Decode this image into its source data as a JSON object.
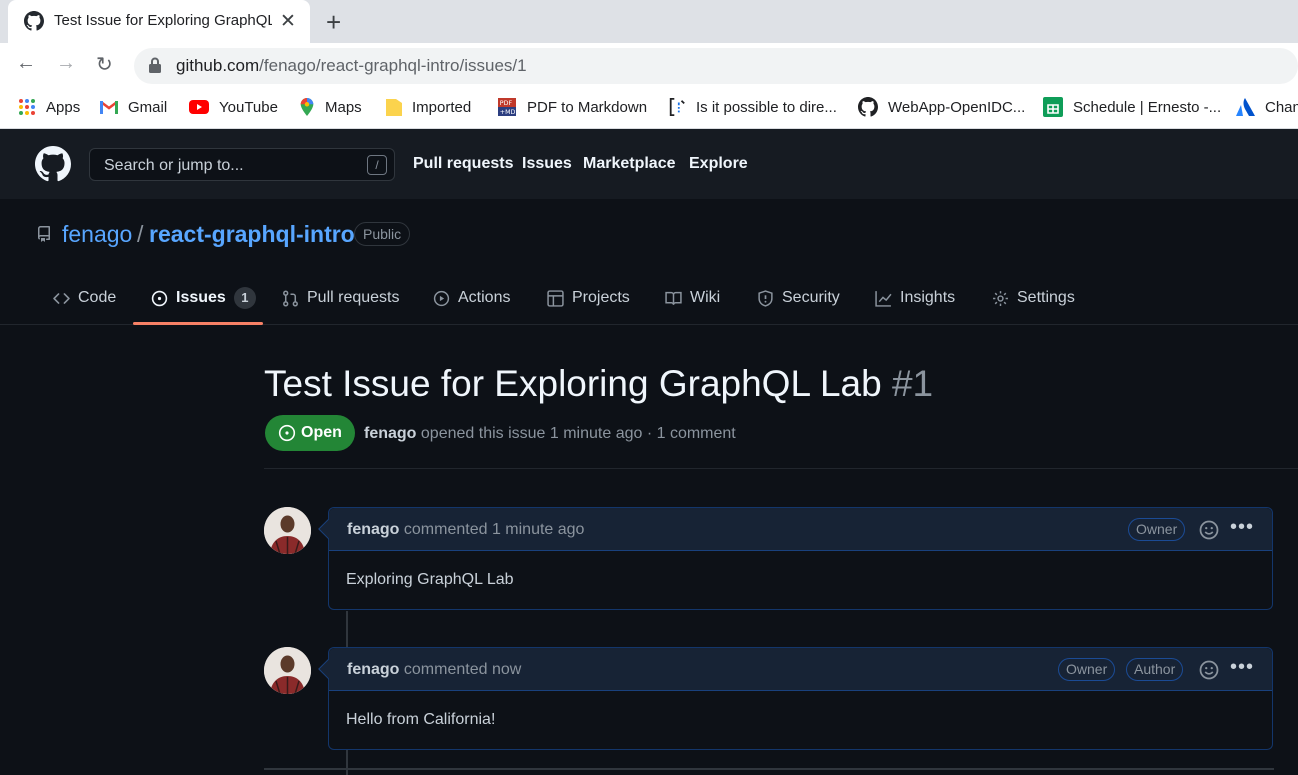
{
  "browser": {
    "tab_title": "Test Issue for Exploring GraphQL",
    "close_glyph": "✕",
    "new_tab_glyph": "+",
    "back_glyph": "←",
    "forward_glyph": "→",
    "reload_glyph": "↻",
    "url_host": "github.com",
    "url_path": "/fenago/react-graphql-intro/issues/1",
    "bookmarks": [
      {
        "label": "Apps",
        "icon": "apps-grid-icon"
      },
      {
        "label": "Gmail",
        "icon": "gmail-icon"
      },
      {
        "label": "YouTube",
        "icon": "youtube-icon"
      },
      {
        "label": "Maps",
        "icon": "maps-pin-icon"
      },
      {
        "label": "Imported",
        "icon": "folder-icon"
      },
      {
        "label": "PDF to Markdown",
        "icon": "pdf-md-icon"
      },
      {
        "label": "Is it possible to dire...",
        "icon": "bracket-icon"
      },
      {
        "label": "WebApp-OpenIDC...",
        "icon": "github-icon"
      },
      {
        "label": "Schedule | Ernesto -...",
        "icon": "sheets-icon"
      },
      {
        "label": "Chan",
        "icon": "atlassian-icon"
      }
    ]
  },
  "header": {
    "search_placeholder": "Search or jump to...",
    "search_key": "/",
    "nav": [
      "Pull requests",
      "Issues",
      "Marketplace",
      "Explore"
    ]
  },
  "repo": {
    "owner": "fenago",
    "separator": "/",
    "name": "react-graphql-intro",
    "visibility": "Public",
    "tabs": [
      {
        "label": "Code",
        "icon": "code-icon"
      },
      {
        "label": "Issues",
        "icon": "issue-opened-icon",
        "count": "1"
      },
      {
        "label": "Pull requests",
        "icon": "git-pull-request-icon"
      },
      {
        "label": "Actions",
        "icon": "play-icon"
      },
      {
        "label": "Projects",
        "icon": "table-icon"
      },
      {
        "label": "Wiki",
        "icon": "book-icon"
      },
      {
        "label": "Security",
        "icon": "shield-icon"
      },
      {
        "label": "Insights",
        "icon": "graph-icon"
      },
      {
        "label": "Settings",
        "icon": "gear-icon"
      }
    ],
    "active_tab": "Issues"
  },
  "issue": {
    "title": "Test Issue for Exploring GraphQL Lab",
    "number": "#1",
    "state": "Open",
    "author": "fenago",
    "meta": "opened this issue 1 minute ago · 1 comment"
  },
  "comments": [
    {
      "author": "fenago",
      "action": "commented 1 minute ago",
      "badges": [
        "Owner"
      ],
      "body": "Exploring GraphQL Lab"
    },
    {
      "author": "fenago",
      "action": "commented now",
      "badges": [
        "Owner",
        "Author"
      ],
      "body": "Hello from California!"
    }
  ],
  "colors": {
    "accent_link": "#58a6ff",
    "open_green": "#238636",
    "tab_underline": "#f78166",
    "bg": "#0d1117",
    "header_bg": "#161b22"
  }
}
